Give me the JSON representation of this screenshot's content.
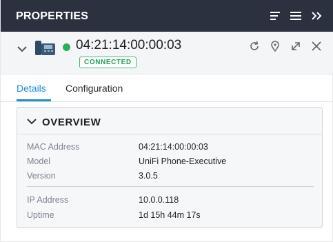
{
  "panel": {
    "title": "PROPERTIES"
  },
  "device": {
    "name": "04:21:14:00:00:03",
    "status": "CONNECTED"
  },
  "tabs": [
    {
      "label": "Details",
      "active": true
    },
    {
      "label": "Configuration",
      "active": false
    }
  ],
  "overview": {
    "title": "OVERVIEW",
    "rows": [
      {
        "key": "MAC Address",
        "value": "04:21:14:00:00:03"
      },
      {
        "key": "Model",
        "value": "UniFi Phone-Executive"
      },
      {
        "key": "Version",
        "value": "3.0.5"
      },
      {
        "key": "IP Address",
        "value": "10.0.0.118"
      },
      {
        "key": "Uptime",
        "value": "1d 15h 44m 17s"
      }
    ]
  },
  "icons": {
    "titlebar": [
      "sort-lines-icon",
      "menu-icon",
      "double-chevron-right-icon"
    ],
    "actions": [
      "refresh-icon",
      "location-pin-icon",
      "expand-icon",
      "close-icon"
    ]
  },
  "colors": {
    "titlebar_bg": "#2c3140",
    "accent": "#1a8dd6",
    "connected": "#27ae60"
  }
}
